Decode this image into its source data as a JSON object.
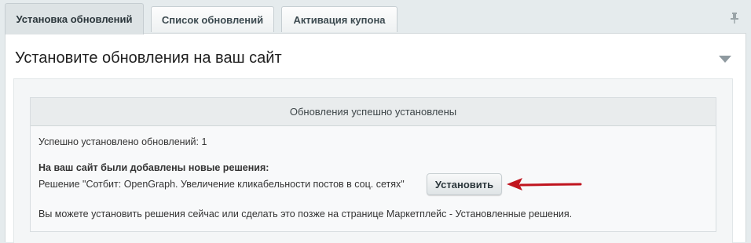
{
  "tabs": [
    {
      "label": "Установка обновлений",
      "active": true
    },
    {
      "label": "Список обновлений",
      "active": false
    },
    {
      "label": "Активация купона",
      "active": false
    }
  ],
  "icons": {
    "pin": "pin-icon",
    "collapse": "chevron-down-icon",
    "arrow": "arrow-left-icon"
  },
  "panel": {
    "title": "Установите обновления на ваш сайт"
  },
  "message": {
    "header": "Обновления успешно установлены",
    "installed_count_text": "Успешно установлено обновлений: 1",
    "new_solutions_heading": "На ваш сайт были добавлены новые решения:",
    "solution_text": "Решение \"Сотбит: OpenGraph. Увеличение кликабельности постов в соц. сетях\"",
    "install_button": "Установить",
    "footer_text": "Вы можете установить решения сейчас или сделать это позже на странице Маркетплейс - Установленные решения."
  },
  "colors": {
    "arrow": "#c0141e",
    "background": "#e5ebed"
  }
}
